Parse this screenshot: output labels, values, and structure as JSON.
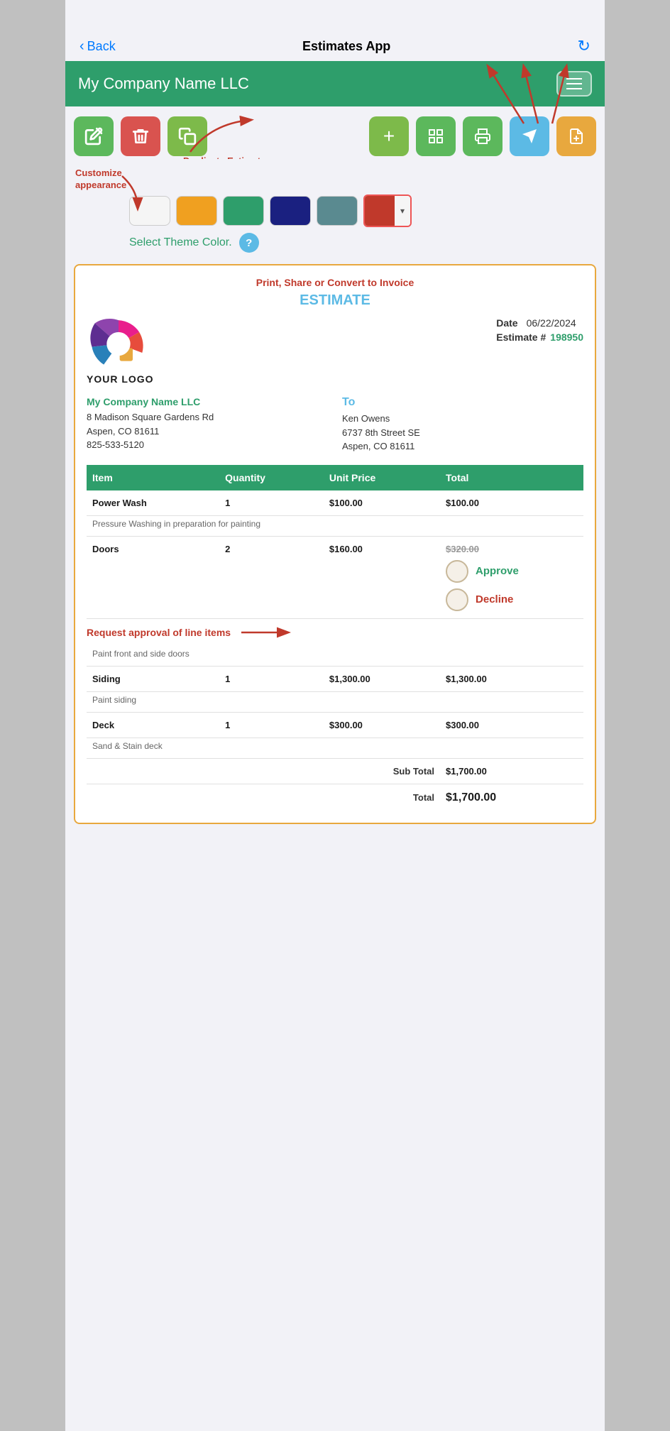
{
  "nav": {
    "back_label": "Back",
    "title": "Estimates App",
    "refresh_icon": "↻"
  },
  "header": {
    "company_name": "My Company Name LLC",
    "menu_icon": "☰"
  },
  "toolbar": {
    "left_buttons": [
      {
        "id": "edit",
        "icon": "✎",
        "color": "green",
        "label": "edit-button"
      },
      {
        "id": "delete",
        "icon": "🗑",
        "color": "red",
        "label": "delete-button"
      },
      {
        "id": "duplicate",
        "icon": "⧉",
        "color": "olive",
        "label": "duplicate-button"
      }
    ],
    "right_buttons": [
      {
        "id": "add",
        "icon": "+",
        "color": "plus",
        "label": "add-button"
      },
      {
        "id": "grid",
        "icon": "⊞",
        "color": "grid",
        "label": "grid-button"
      },
      {
        "id": "print",
        "icon": "🖨",
        "color": "print",
        "label": "print-button"
      },
      {
        "id": "share",
        "icon": "➤",
        "color": "share",
        "label": "share-button"
      },
      {
        "id": "convert",
        "icon": "📋",
        "color": "doc",
        "label": "convert-button"
      }
    ]
  },
  "annotations": {
    "duplicate_estimate": "Duplicate Estimate",
    "customize_appearance": "Customize appearance",
    "print_share": "Print, Share or Convert to Invoice",
    "request_approval": "Request approval of line items"
  },
  "theme": {
    "label": "Select Theme Color.",
    "help_icon": "?",
    "swatches": [
      {
        "color": "#f5f5f5",
        "selected": false
      },
      {
        "color": "#f0a020",
        "selected": false
      },
      {
        "color": "#2e9e6b",
        "selected": false
      },
      {
        "color": "#1a2080",
        "selected": false
      },
      {
        "color": "#5a8a90",
        "selected": false
      },
      {
        "color": "#c0392b",
        "selected": true
      }
    ]
  },
  "estimate": {
    "title": "ESTIMATE",
    "logo_text": "YOUR LOGO",
    "date_label": "Date",
    "date_value": "06/22/2024",
    "estimate_hash": "Estimate #",
    "estimate_number": "198950",
    "from": {
      "name": "My Company Name LLC",
      "address_line1": "8 Madison Square Gardens Rd",
      "address_line2": "Aspen, CO 81611",
      "phone": "825-533-5120"
    },
    "to_label": "To",
    "to": {
      "name": "Ken Owens",
      "address_line1": "6737 8th Street SE",
      "address_line2": "Aspen, CO 81611"
    },
    "table": {
      "headers": [
        "Item",
        "Quantity",
        "Unit Price",
        "Total"
      ],
      "rows": [
        {
          "type": "item",
          "item": "Power Wash",
          "quantity": "1",
          "unit_price": "$100.00",
          "total": "$100.00",
          "description": "Pressure Washing in preparation for painting"
        },
        {
          "type": "item",
          "item": "Doors",
          "quantity": "2",
          "unit_price": "$160.00",
          "total": "$320.00",
          "has_approval": true,
          "approve_label": "Approve",
          "decline_label": "Decline",
          "description": "Paint front and side doors"
        },
        {
          "type": "item",
          "item": "Siding",
          "quantity": "1",
          "unit_price": "$1,300.00",
          "total": "$1,300.00",
          "description": "Paint siding"
        },
        {
          "type": "item",
          "item": "Deck",
          "quantity": "1",
          "unit_price": "$300.00",
          "total": "$300.00",
          "description": "Sand & Stain deck"
        }
      ],
      "sub_total_label": "Sub Total",
      "sub_total_value": "$1,700.00",
      "total_label": "Total",
      "total_value": "$1,700.00"
    }
  },
  "colors": {
    "green": "#2e9e6b",
    "red": "#c0392b",
    "blue": "#5cbae5",
    "orange": "#e8a83e"
  }
}
